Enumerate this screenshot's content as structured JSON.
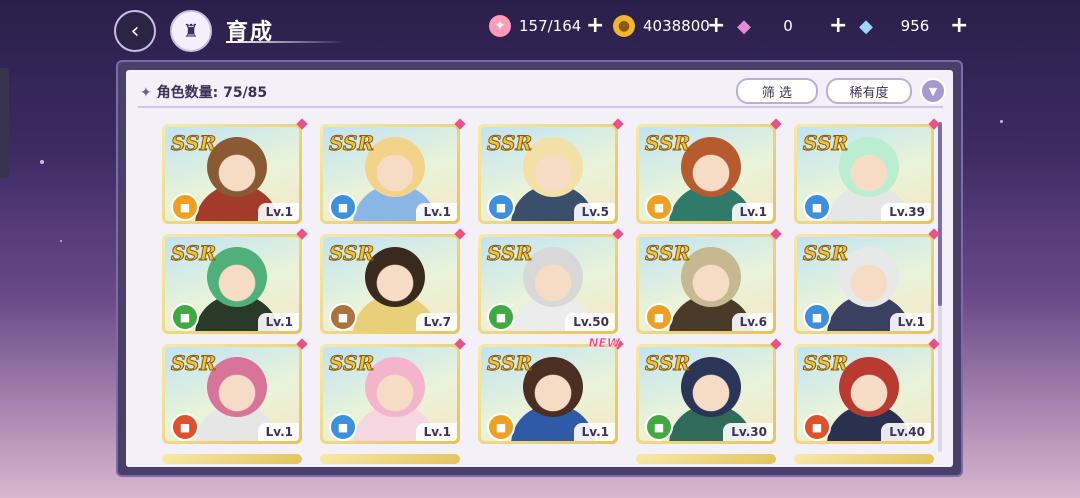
{
  "header": {
    "title": "育成"
  },
  "currencies": [
    {
      "icon": "candy-icon",
      "value": "157/164"
    },
    {
      "icon": "gold-coin-icon",
      "value": "4038800"
    },
    {
      "icon": "pink-diamond-icon",
      "value": "0"
    },
    {
      "icon": "blue-diamond-icon",
      "value": "956"
    }
  ],
  "panel": {
    "count_label": "角色数量: 75/85",
    "filter_label": "筛 选",
    "sort_label": "稀有度"
  },
  "cards": [
    {
      "rarity": "SSR",
      "level": "Lv.1",
      "element": "orange"
    },
    {
      "rarity": "SSR",
      "level": "Lv.1",
      "element": "blue"
    },
    {
      "rarity": "SSR",
      "level": "Lv.5",
      "element": "blue"
    },
    {
      "rarity": "SSR",
      "level": "Lv.1",
      "element": "orange"
    },
    {
      "rarity": "SSR",
      "level": "Lv.39",
      "element": "blue"
    },
    {
      "rarity": "SSR",
      "level": "Lv.1",
      "element": "green"
    },
    {
      "rarity": "SSR",
      "level": "Lv.7",
      "element": "brown"
    },
    {
      "rarity": "SSR",
      "level": "Lv.50",
      "element": "green"
    },
    {
      "rarity": "SSR",
      "level": "Lv.6",
      "element": "orange"
    },
    {
      "rarity": "SSR",
      "level": "Lv.1",
      "element": "blue"
    },
    {
      "rarity": "SSR",
      "level": "Lv.1",
      "element": "red"
    },
    {
      "rarity": "SSR",
      "level": "Lv.1",
      "element": "blue"
    },
    {
      "rarity": "SSR",
      "level": "Lv.1",
      "element": "orange",
      "badge": "NEW"
    },
    {
      "rarity": "SSR",
      "level": "Lv.30",
      "element": "green"
    },
    {
      "rarity": "SSR",
      "level": "Lv.40",
      "element": "red"
    }
  ]
}
